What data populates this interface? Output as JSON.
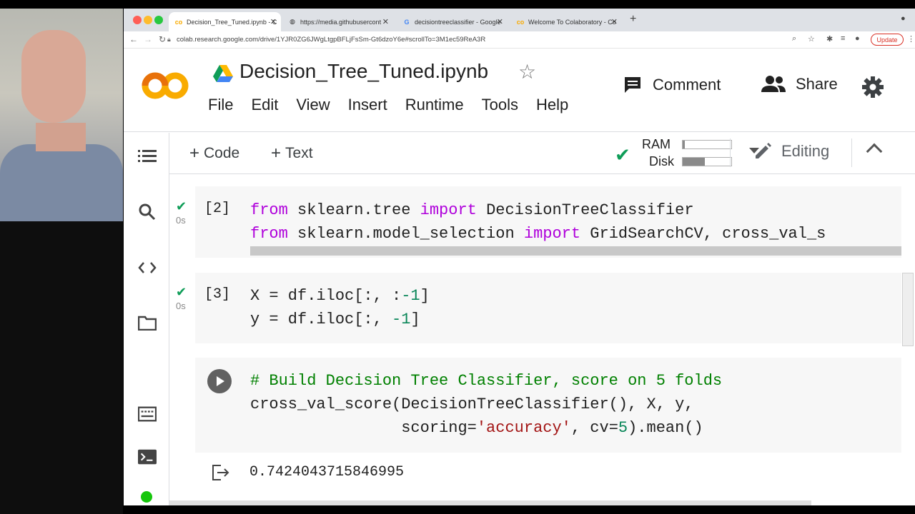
{
  "browser": {
    "tabs": [
      {
        "title": "Decision_Tree_Tuned.ipynb - C",
        "favicon": "colab-icon",
        "active": true
      },
      {
        "title": "https://media.githubusercont",
        "favicon": "globe-icon",
        "active": false
      },
      {
        "title": "decisiontreeclassifier - Google",
        "favicon": "google-icon",
        "active": false
      },
      {
        "title": "Welcome To Colaboratory - Co",
        "favicon": "colab-icon",
        "active": false
      }
    ],
    "url": "colab.research.google.com/drive/1YJR0ZG6JWgLtgpBFLjFsSm-Gt6dzoY6e#scrollTo=3M1ec59ReA3R",
    "update_label": "Update"
  },
  "colab": {
    "title": "Decision_Tree_Tuned.ipynb",
    "menu": [
      "File",
      "Edit",
      "View",
      "Insert",
      "Runtime",
      "Tools",
      "Help"
    ],
    "comment_label": "Comment",
    "share_label": "Share"
  },
  "toolbar": {
    "add_code_label": "Code",
    "add_text_label": "Text",
    "ram_label": "RAM",
    "disk_label": "Disk",
    "ram_usage": 0.04,
    "disk_usage": 0.45,
    "editing_label": "Editing"
  },
  "cells": {
    "c1": {
      "number": "[2]",
      "time": "0s"
    },
    "c2": {
      "number": "[3]",
      "time": "0s"
    }
  },
  "output": {
    "value": "0.7424043715846995"
  },
  "colors": {
    "accent_green": "#0f9d58",
    "keyword": "#af00db",
    "number": "#098658",
    "string": "#a31515",
    "comment": "#008000",
    "colab_orange": "#f9ab00"
  }
}
